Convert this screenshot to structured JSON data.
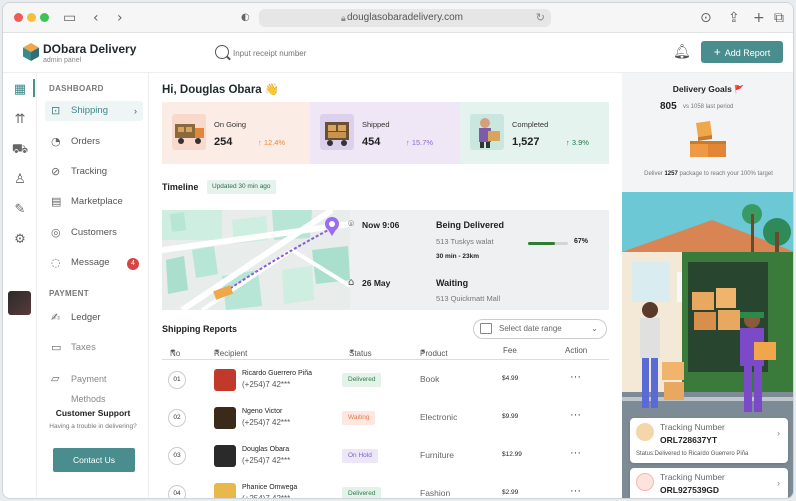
{
  "browser": {
    "url": "douglasobaradelivery.com"
  },
  "header": {
    "brand": "DObara Delivery",
    "brand_sub": "admin panel",
    "search_placeholder": "Input receipt number",
    "add_report_label": "Add Report"
  },
  "nav": {
    "dashboard_section": "DASHBOARD",
    "items": [
      {
        "label": "Shipping",
        "icon": "shipping-box-icon",
        "active": true
      },
      {
        "label": "Orders",
        "icon": "orders-icon"
      },
      {
        "label": "Tracking",
        "icon": "tracking-icon"
      },
      {
        "label": "Marketplace",
        "icon": "marketplace-icon"
      },
      {
        "label": "Customers",
        "icon": "customers-icon"
      },
      {
        "label": "Message",
        "icon": "message-icon",
        "badge": "4"
      }
    ],
    "payment_section": "PAYMENT",
    "payment_items": [
      {
        "label": "Ledger",
        "icon": "ledger-icon"
      },
      {
        "label": "Taxes",
        "icon": "taxes-icon"
      },
      {
        "label": "Payment Methods",
        "icon": "payment-methods-icon"
      }
    ],
    "support_title": "Customer Support",
    "support_sub": "Having a trouble in delivering?",
    "contact_label": "Contact Us"
  },
  "main": {
    "greeting": "Hi, Douglas Obara 👋",
    "stats": [
      {
        "label": "On Going",
        "value": "254",
        "change": "↑ 12.4%",
        "color": "#e8873a",
        "bg": "#fcece6"
      },
      {
        "label": "Shipped",
        "value": "454",
        "change": "↑ 15.7%",
        "color": "#8b6bd1",
        "bg": "#efe6f6"
      },
      {
        "label": "Completed",
        "value": "1,527",
        "change": "↑ 3.9%",
        "color": "#1e7a4a",
        "bg": "#e5f3ee"
      }
    ],
    "timeline": {
      "title": "Timeline",
      "updated": "Updated 30 min ago",
      "events": [
        {
          "time": "Now 9:06",
          "status": "Being Delivered",
          "address": "513 Tuskys walat",
          "progress": 0.67,
          "progress_label": "67%",
          "distance": "30 min - 23km"
        },
        {
          "time": "26 May",
          "status": "Waiting",
          "address": "513 Quickmatt Mall"
        }
      ]
    },
    "reports": {
      "title": "Shipping Reports",
      "date_placeholder": "Select date range",
      "columns": [
        "No",
        "Recipient",
        "Status",
        "Product",
        "Fee",
        "Action"
      ],
      "rows": [
        {
          "no": "01",
          "name": "Ricardo Guerrero Piña",
          "phone": "(+254)7 42***",
          "status": "Delivered",
          "product": "Book",
          "fee": "$4.99"
        },
        {
          "no": "02",
          "name": "Ngeno Victor",
          "phone": "(+254)7 42***",
          "status": "Waiting",
          "product": "Electronic",
          "fee": "$9.99"
        },
        {
          "no": "03",
          "name": "Douglas Obara",
          "phone": "(+254)7 42***",
          "status": "On Hold",
          "product": "Furniture",
          "fee": "$12.99"
        },
        {
          "no": "04",
          "name": "Phanice Omwega",
          "phone": "(+254)7 42***",
          "status": "Delivered",
          "product": "Fashion",
          "fee": "$2.99"
        }
      ],
      "action_label": "···"
    }
  },
  "right": {
    "goal_title": "Delivery Goals",
    "goal_flag": "🚩",
    "goal_value": "805",
    "goal_vs": "vs 1058 last period",
    "target_prefix": "Deliver",
    "target_value": "1257",
    "target_suffix": "package to reach your 100% target",
    "tracking": [
      {
        "label": "Tracking Number",
        "number": "ORL728637YT",
        "status": "Status:Delivered to Ricardo Guerrero Piña"
      },
      {
        "label": "Tracking Number",
        "number": "ORL927539GD"
      }
    ]
  },
  "status_colors": {
    "Delivered": {
      "bg": "#e4f3ea",
      "fg": "#2d7a4b"
    },
    "Waiting": {
      "bg": "#fde7e0",
      "fg": "#e07a4c"
    },
    "On Hold": {
      "bg": "#ece7f7",
      "fg": "#7a62c4"
    }
  }
}
